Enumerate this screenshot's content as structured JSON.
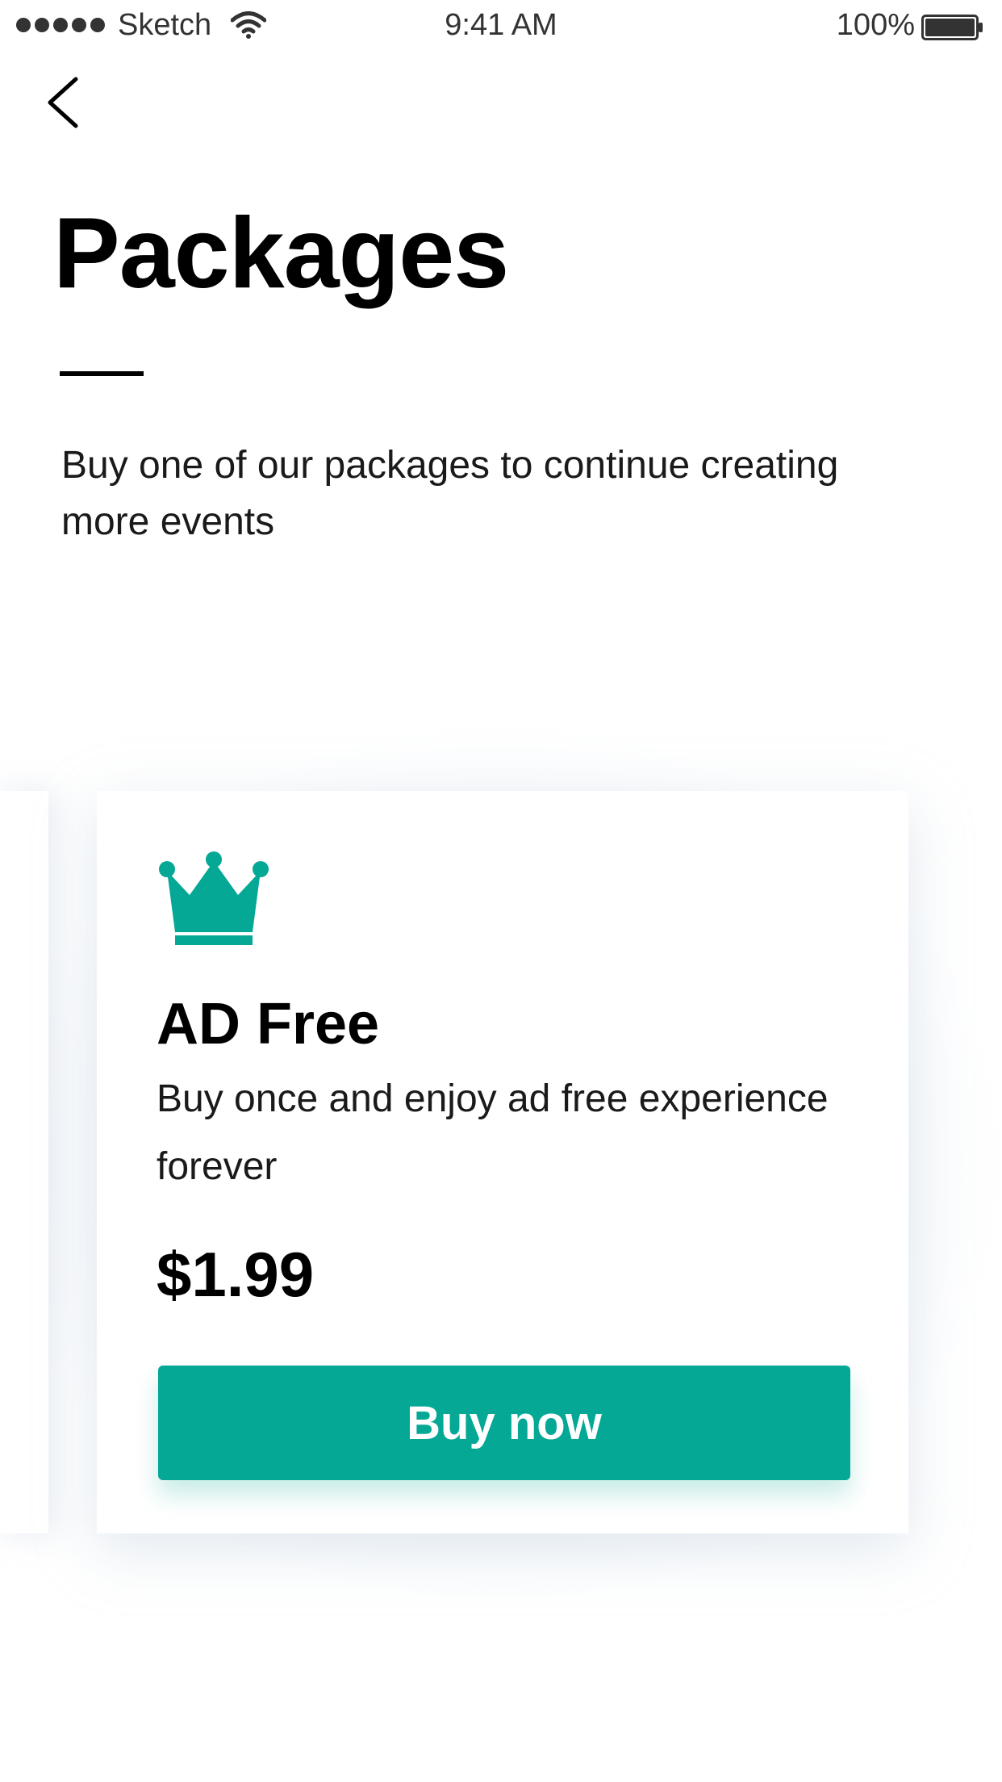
{
  "status_bar": {
    "carrier": "Sketch",
    "time": "9:41 AM",
    "battery_percent": "100%"
  },
  "header": {
    "title": "Packages",
    "subtitle": "Buy one of our packages to continue creating more events"
  },
  "package": {
    "icon": "crown-icon",
    "name": "AD Free",
    "description": "Buy once and enjoy ad free experience forever",
    "price": "$1.99",
    "button_label": "Buy now"
  },
  "colors": {
    "accent": "#04a895",
    "text": "#000000",
    "background": "#ffffff"
  }
}
